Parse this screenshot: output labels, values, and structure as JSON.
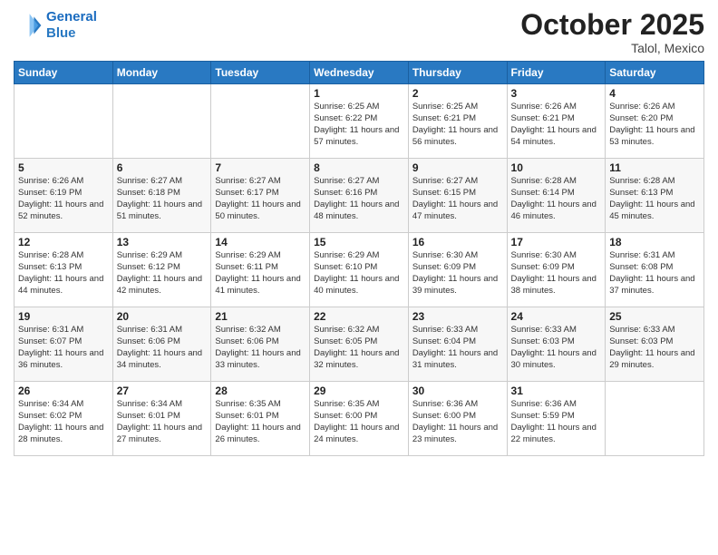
{
  "header": {
    "logo_line1": "General",
    "logo_line2": "Blue",
    "month": "October 2025",
    "location": "Talol, Mexico"
  },
  "weekdays": [
    "Sunday",
    "Monday",
    "Tuesday",
    "Wednesday",
    "Thursday",
    "Friday",
    "Saturday"
  ],
  "weeks": [
    [
      null,
      null,
      null,
      {
        "day": "1",
        "sunrise": "6:25 AM",
        "sunset": "6:22 PM",
        "daylight": "11 hours and 57 minutes."
      },
      {
        "day": "2",
        "sunrise": "6:25 AM",
        "sunset": "6:21 PM",
        "daylight": "11 hours and 56 minutes."
      },
      {
        "day": "3",
        "sunrise": "6:26 AM",
        "sunset": "6:21 PM",
        "daylight": "11 hours and 54 minutes."
      },
      {
        "day": "4",
        "sunrise": "6:26 AM",
        "sunset": "6:20 PM",
        "daylight": "11 hours and 53 minutes."
      }
    ],
    [
      {
        "day": "5",
        "sunrise": "6:26 AM",
        "sunset": "6:19 PM",
        "daylight": "11 hours and 52 minutes."
      },
      {
        "day": "6",
        "sunrise": "6:27 AM",
        "sunset": "6:18 PM",
        "daylight": "11 hours and 51 minutes."
      },
      {
        "day": "7",
        "sunrise": "6:27 AM",
        "sunset": "6:17 PM",
        "daylight": "11 hours and 50 minutes."
      },
      {
        "day": "8",
        "sunrise": "6:27 AM",
        "sunset": "6:16 PM",
        "daylight": "11 hours and 48 minutes."
      },
      {
        "day": "9",
        "sunrise": "6:27 AM",
        "sunset": "6:15 PM",
        "daylight": "11 hours and 47 minutes."
      },
      {
        "day": "10",
        "sunrise": "6:28 AM",
        "sunset": "6:14 PM",
        "daylight": "11 hours and 46 minutes."
      },
      {
        "day": "11",
        "sunrise": "6:28 AM",
        "sunset": "6:13 PM",
        "daylight": "11 hours and 45 minutes."
      }
    ],
    [
      {
        "day": "12",
        "sunrise": "6:28 AM",
        "sunset": "6:13 PM",
        "daylight": "11 hours and 44 minutes."
      },
      {
        "day": "13",
        "sunrise": "6:29 AM",
        "sunset": "6:12 PM",
        "daylight": "11 hours and 42 minutes."
      },
      {
        "day": "14",
        "sunrise": "6:29 AM",
        "sunset": "6:11 PM",
        "daylight": "11 hours and 41 minutes."
      },
      {
        "day": "15",
        "sunrise": "6:29 AM",
        "sunset": "6:10 PM",
        "daylight": "11 hours and 40 minutes."
      },
      {
        "day": "16",
        "sunrise": "6:30 AM",
        "sunset": "6:09 PM",
        "daylight": "11 hours and 39 minutes."
      },
      {
        "day": "17",
        "sunrise": "6:30 AM",
        "sunset": "6:09 PM",
        "daylight": "11 hours and 38 minutes."
      },
      {
        "day": "18",
        "sunrise": "6:31 AM",
        "sunset": "6:08 PM",
        "daylight": "11 hours and 37 minutes."
      }
    ],
    [
      {
        "day": "19",
        "sunrise": "6:31 AM",
        "sunset": "6:07 PM",
        "daylight": "11 hours and 36 minutes."
      },
      {
        "day": "20",
        "sunrise": "6:31 AM",
        "sunset": "6:06 PM",
        "daylight": "11 hours and 34 minutes."
      },
      {
        "day": "21",
        "sunrise": "6:32 AM",
        "sunset": "6:06 PM",
        "daylight": "11 hours and 33 minutes."
      },
      {
        "day": "22",
        "sunrise": "6:32 AM",
        "sunset": "6:05 PM",
        "daylight": "11 hours and 32 minutes."
      },
      {
        "day": "23",
        "sunrise": "6:33 AM",
        "sunset": "6:04 PM",
        "daylight": "11 hours and 31 minutes."
      },
      {
        "day": "24",
        "sunrise": "6:33 AM",
        "sunset": "6:03 PM",
        "daylight": "11 hours and 30 minutes."
      },
      {
        "day": "25",
        "sunrise": "6:33 AM",
        "sunset": "6:03 PM",
        "daylight": "11 hours and 29 minutes."
      }
    ],
    [
      {
        "day": "26",
        "sunrise": "6:34 AM",
        "sunset": "6:02 PM",
        "daylight": "11 hours and 28 minutes."
      },
      {
        "day": "27",
        "sunrise": "6:34 AM",
        "sunset": "6:01 PM",
        "daylight": "11 hours and 27 minutes."
      },
      {
        "day": "28",
        "sunrise": "6:35 AM",
        "sunset": "6:01 PM",
        "daylight": "11 hours and 26 minutes."
      },
      {
        "day": "29",
        "sunrise": "6:35 AM",
        "sunset": "6:00 PM",
        "daylight": "11 hours and 24 minutes."
      },
      {
        "day": "30",
        "sunrise": "6:36 AM",
        "sunset": "6:00 PM",
        "daylight": "11 hours and 23 minutes."
      },
      {
        "day": "31",
        "sunrise": "6:36 AM",
        "sunset": "5:59 PM",
        "daylight": "11 hours and 22 minutes."
      },
      null
    ]
  ]
}
